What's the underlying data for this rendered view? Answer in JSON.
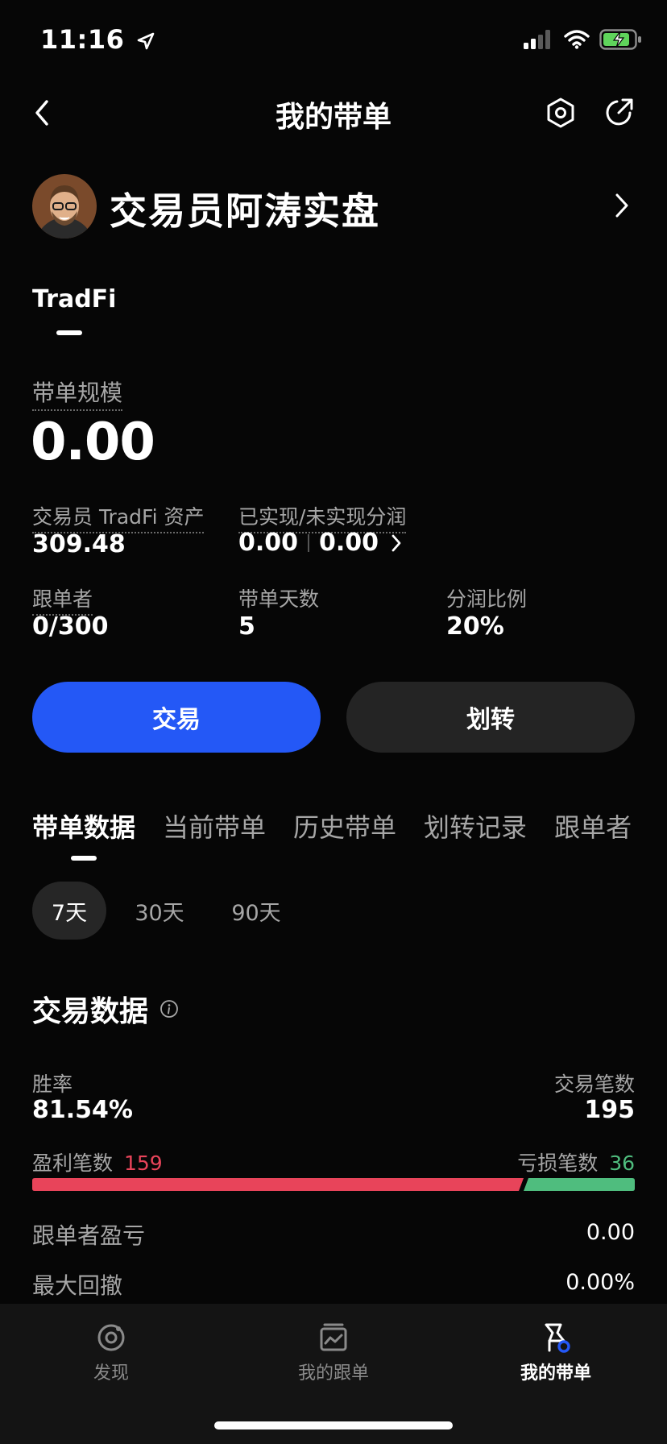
{
  "status_bar": {
    "time": "11:16"
  },
  "header": {
    "title": "我的带单"
  },
  "profile": {
    "name": "交易员阿涛实盘"
  },
  "account_tab": {
    "label": "TradFi"
  },
  "scale": {
    "label": "带单规模",
    "value": "0.00"
  },
  "stats": {
    "trader_assets_label": "交易员 TradFi 资产",
    "trader_assets_value": "309.48",
    "profit_label": "已实现/未实现分润",
    "realized_value": "0.00",
    "unrealized_value": "0.00",
    "followers_label": "跟单者",
    "followers_value": "0/300",
    "days_label": "带单天数",
    "days_value": "5",
    "share_ratio_label": "分润比例",
    "share_ratio_value": "20%"
  },
  "actions": {
    "trade_label": "交易",
    "transfer_label": "划转"
  },
  "tabs": [
    {
      "label": "带单数据",
      "active": true
    },
    {
      "label": "当前带单",
      "active": false
    },
    {
      "label": "历史带单",
      "active": false
    },
    {
      "label": "划转记录",
      "active": false
    },
    {
      "label": "跟单者",
      "active": false
    }
  ],
  "periods": [
    {
      "label": "7天",
      "active": true
    },
    {
      "label": "30天",
      "active": false
    },
    {
      "label": "90天",
      "active": false
    }
  ],
  "trade_data": {
    "title": "交易数据",
    "win_rate_label": "胜率",
    "win_rate_value": "81.54%",
    "trade_count_label": "交易笔数",
    "trade_count_value": "195",
    "profit_trades_label": "盈利笔数",
    "profit_trades_value": "159",
    "loss_trades_label": "亏损笔数",
    "loss_trades_value": "36",
    "profit_fraction": 0.8154,
    "follower_pnl_label": "跟单者盈亏",
    "follower_pnl_value": "0.00",
    "max_drawdown_label": "最大回撤",
    "max_drawdown_value": "0.00%"
  },
  "colors": {
    "accent": "#2458f6",
    "profit": "#e8445a",
    "loss": "#4fbd7e"
  },
  "tabbar": [
    {
      "label": "发现",
      "icon": "discover-icon",
      "active": false
    },
    {
      "label": "我的跟单",
      "icon": "copy-trading-icon",
      "active": false
    },
    {
      "label": "我的带单",
      "icon": "lead-trading-icon",
      "active": true
    }
  ]
}
